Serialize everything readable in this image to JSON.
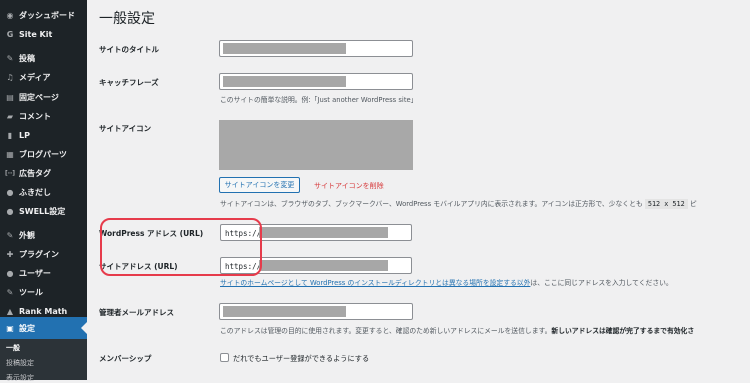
{
  "sidebar": {
    "items": [
      {
        "label": "ダッシュボード",
        "icon": "dashboard-icon",
        "glyph": "◉"
      },
      {
        "label": "Site Kit",
        "icon": "sitekit-icon",
        "glyph": "G"
      },
      {
        "label": "投稿",
        "icon": "pin-icon",
        "glyph": "✎"
      },
      {
        "label": "メディア",
        "icon": "media-icon",
        "glyph": "♫"
      },
      {
        "label": "固定ページ",
        "icon": "page-icon",
        "glyph": "▤"
      },
      {
        "label": "コメント",
        "icon": "comment-icon",
        "glyph": "▰"
      },
      {
        "label": "LP",
        "icon": "lp-icon",
        "glyph": "▮"
      },
      {
        "label": "ブログパーツ",
        "icon": "blogparts-icon",
        "glyph": "▦"
      },
      {
        "label": "広告タグ",
        "icon": "adtag-icon",
        "glyph": "[··]"
      },
      {
        "label": "ふきだし",
        "icon": "balloon-icon",
        "glyph": "●"
      },
      {
        "label": "SWELL設定",
        "icon": "swell-icon",
        "glyph": "●"
      },
      {
        "label": "外観",
        "icon": "appearance-icon",
        "glyph": "✎"
      },
      {
        "label": "プラグイン",
        "icon": "plugin-icon",
        "glyph": "✚"
      },
      {
        "label": "ユーザー",
        "icon": "user-icon",
        "glyph": "●"
      },
      {
        "label": "ツール",
        "icon": "tool-icon",
        "glyph": "✎"
      },
      {
        "label": "Rank Math",
        "icon": "rankmath-icon",
        "glyph": "▲"
      },
      {
        "label": "設定",
        "icon": "settings-icon",
        "glyph": "▣"
      }
    ],
    "submenu": [
      "一般",
      "投稿設定",
      "表示設定"
    ]
  },
  "page": {
    "title": "一般設定",
    "site_title_label": "サイトのタイトル",
    "tagline_label": "キャッチフレーズ",
    "tagline_desc": "このサイトの簡単な説明。例:「Just another WordPress site」",
    "site_icon_label": "サイトアイコン",
    "change_icon_button": "サイトアイコンを変更",
    "remove_icon_link": "サイトアイコンを削除",
    "site_icon_desc_pre": "サイトアイコンは、ブラウザのタブ、ブックマークバー、WordPress モバイルアプリ内に表示されます。アイコンは正方形で、少なくとも",
    "site_icon_size": "512 x 512",
    "site_icon_desc_post": "ピ",
    "wp_address_label": "WordPress アドレス (URL)",
    "wp_address_prefix": "https://",
    "site_address_label": "サイトアドレス (URL)",
    "site_address_prefix": "https://",
    "site_address_link": "サイトのホームページとして WordPress のインストールディレクトリとは異なる場所を設定する以外",
    "site_address_after": "は、ここに同じアドレスを入力してください。",
    "admin_email_label": "管理者メールアドレス",
    "admin_email_desc": "このアドレスは管理の目的に使用されます。変更すると、確認のため新しいアドレスにメールを送信します。",
    "admin_email_desc_strong": "新しいアドレスは確認が完了するまで有効化さ",
    "membership_label": "メンバーシップ",
    "membership_checkbox": "だれでもユーザー登録ができるようにする"
  },
  "colors": {
    "sidebar_bg": "#1d2327",
    "active_bg": "#2271b1",
    "highlight": "#e63b4b",
    "link": "#2271b1",
    "danger": "#d63638"
  }
}
